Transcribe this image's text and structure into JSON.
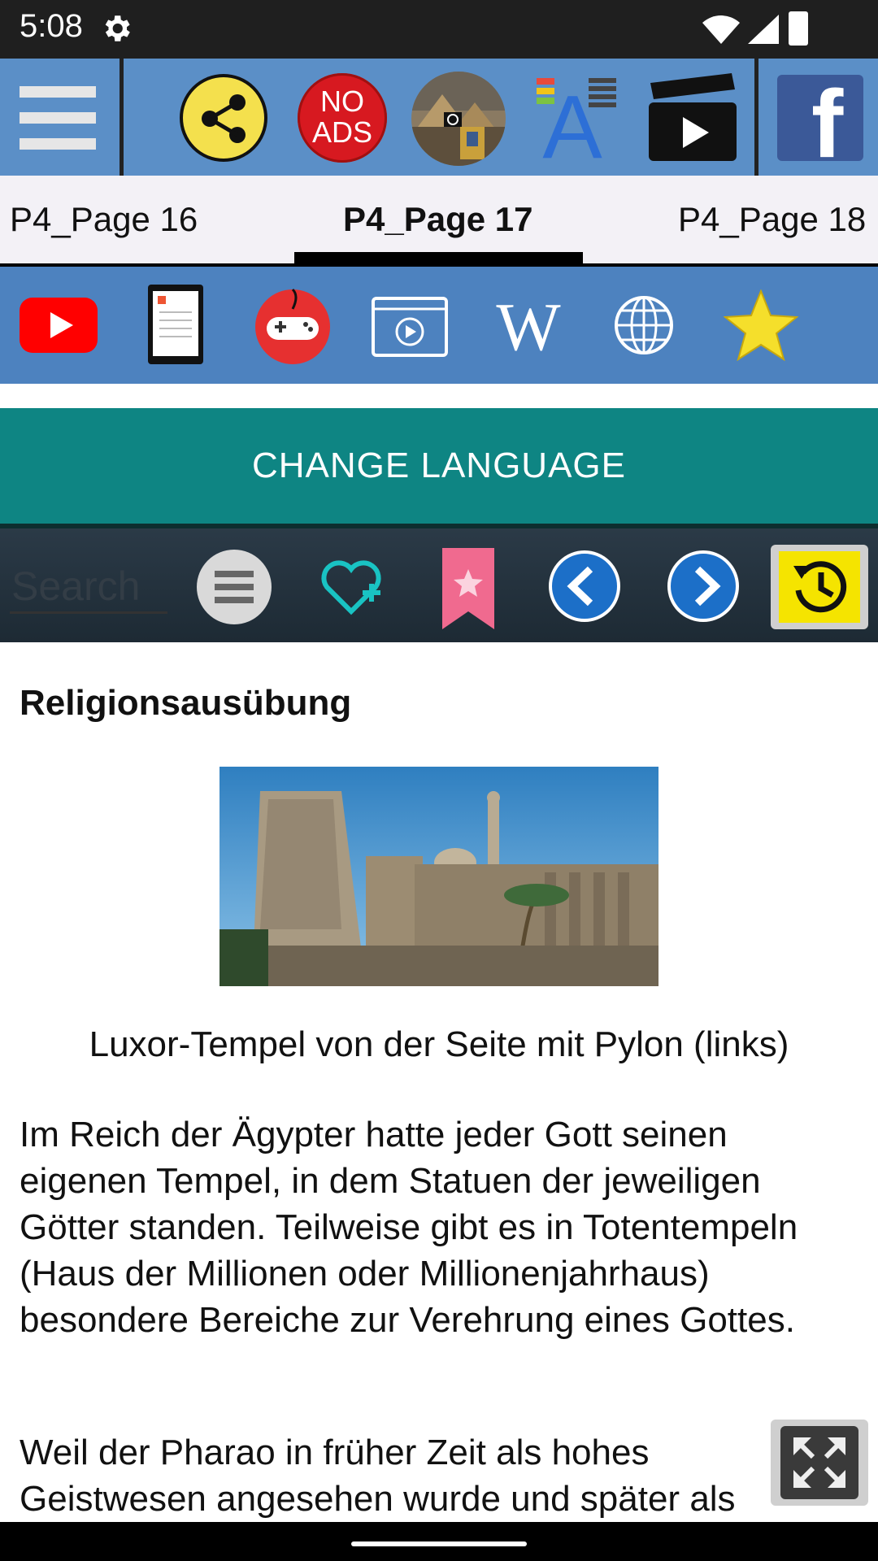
{
  "status": {
    "time": "5:08"
  },
  "toolbar": {
    "icons": [
      "menu-icon",
      "share-icon",
      "no-ads-icon",
      "history-image-icon",
      "font-size-icon",
      "video-clapper-icon",
      "facebook-icon"
    ],
    "no_ads_line1": "NO",
    "no_ads_line2": "ADS",
    "font_letter": "A",
    "facebook_letter": "f"
  },
  "tabs": [
    {
      "label": "P4_Page 16",
      "active": false
    },
    {
      "label": "P4_Page 17",
      "active": true
    },
    {
      "label": "P4_Page 18",
      "active": false
    }
  ],
  "toolbar2": {
    "icons": [
      "youtube-icon",
      "ebook-icon",
      "game-controller-icon",
      "video-player-icon",
      "wikipedia-icon",
      "globe-icon",
      "star-icon"
    ],
    "wiki_letter": "W"
  },
  "change_language": {
    "label": "CHANGE LANGUAGE"
  },
  "searchbar": {
    "placeholder": "Search",
    "icons": [
      "list-menu-icon",
      "heart-add-icon",
      "bookmark-star-icon",
      "arrow-left-icon",
      "arrow-right-icon",
      "history-icon"
    ]
  },
  "article": {
    "heading": "Religionsausübung",
    "caption": "Luxor-Tempel von der Seite mit Pylon (links)",
    "paragraph1": "Im Reich der Ägypter hatte jeder Gott seinen eigenen Tempel, in dem Statuen der jeweiligen Götter standen. Teilweise gibt es in Totentempeln (Haus der Millionen oder Millionenjahrhaus) besondere Bereiche zur Verehrung eines Gottes.",
    "paragraph2": "Weil der Pharao in früher Zeit als hohes Geistwesen angesehen wurde und später als"
  },
  "colors": {
    "toolbar": "#5b8fc7",
    "toolbar2": "#4d82bf",
    "change_language": "#0e8583",
    "history_button": "#f5e400"
  }
}
